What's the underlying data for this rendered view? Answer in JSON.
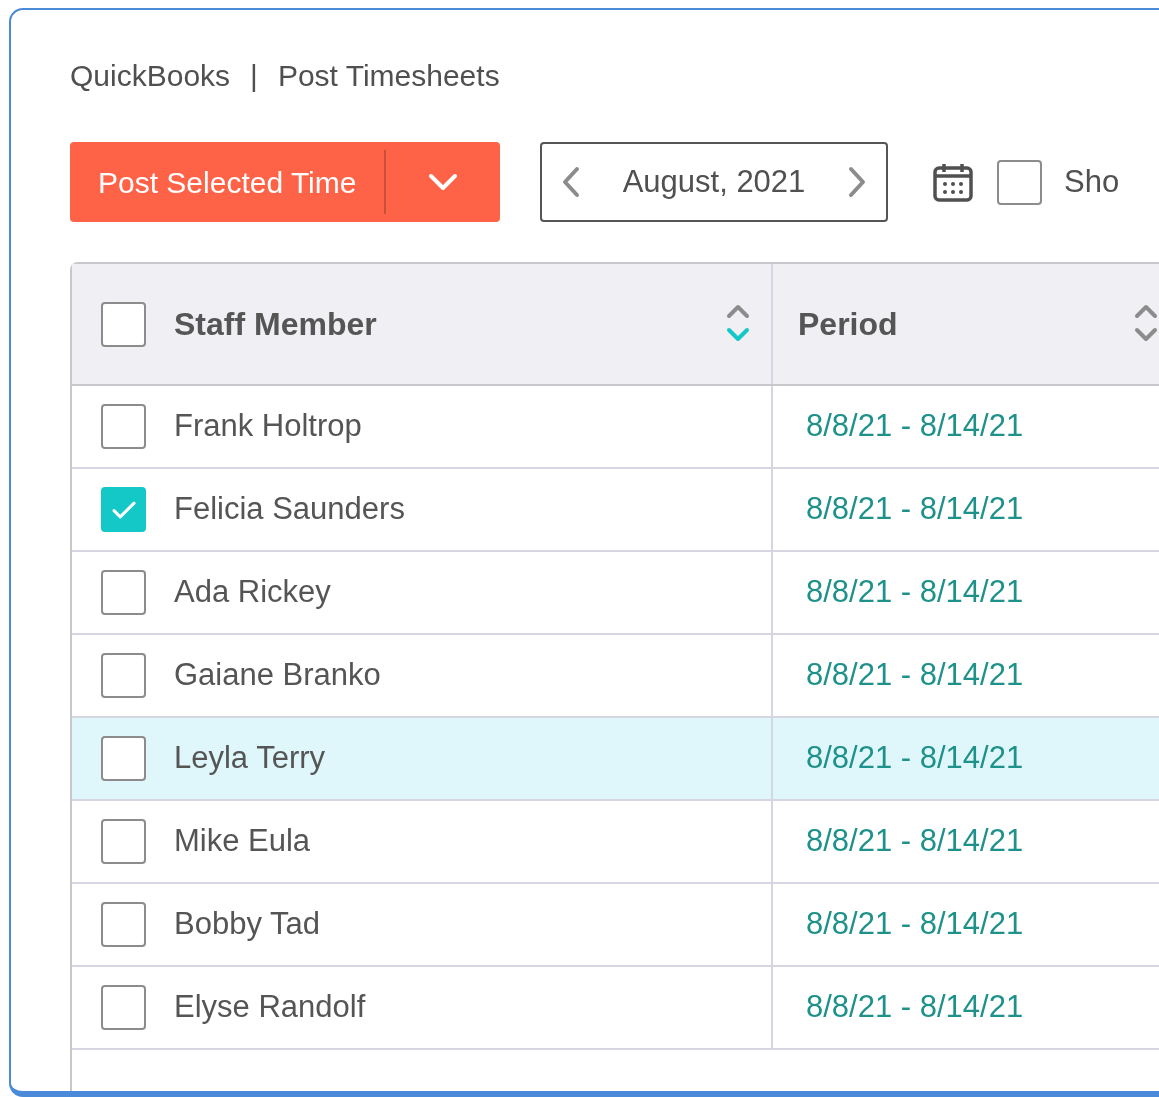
{
  "breadcrumb": {
    "app": "QuickBooks",
    "separator": "|",
    "page": "Post Timesheets"
  },
  "toolbar": {
    "post_button": "Post Selected Time",
    "month": "August, 2021",
    "show_checkbox": {
      "label": "Sho",
      "checked": false
    }
  },
  "table": {
    "select_all_checked": false,
    "columns": [
      {
        "label": "Staff Member",
        "sorted_descending": true
      },
      {
        "label": "Period",
        "sorted_descending": false
      }
    ],
    "rows": [
      {
        "name": "Frank Holtrop",
        "period": "8/8/21 - 8/14/21",
        "checked": false,
        "highlighted": false
      },
      {
        "name": "Felicia Saunders",
        "period": "8/8/21 - 8/14/21",
        "checked": true,
        "highlighted": false
      },
      {
        "name": "Ada Rickey",
        "period": "8/8/21 - 8/14/21",
        "checked": false,
        "highlighted": false
      },
      {
        "name": "Gaiane Branko",
        "period": "8/8/21 - 8/14/21",
        "checked": false,
        "highlighted": false
      },
      {
        "name": "Leyla Terry",
        "period": "8/8/21 - 8/14/21",
        "checked": false,
        "highlighted": true
      },
      {
        "name": "Mike Eula",
        "period": "8/8/21 - 8/14/21",
        "checked": false,
        "highlighted": false
      },
      {
        "name": "Bobby Tad",
        "period": "8/8/21 - 8/14/21",
        "checked": false,
        "highlighted": false
      },
      {
        "name": "Elyse Randolf",
        "period": "8/8/21 - 8/14/21",
        "checked": false,
        "highlighted": false
      }
    ]
  }
}
